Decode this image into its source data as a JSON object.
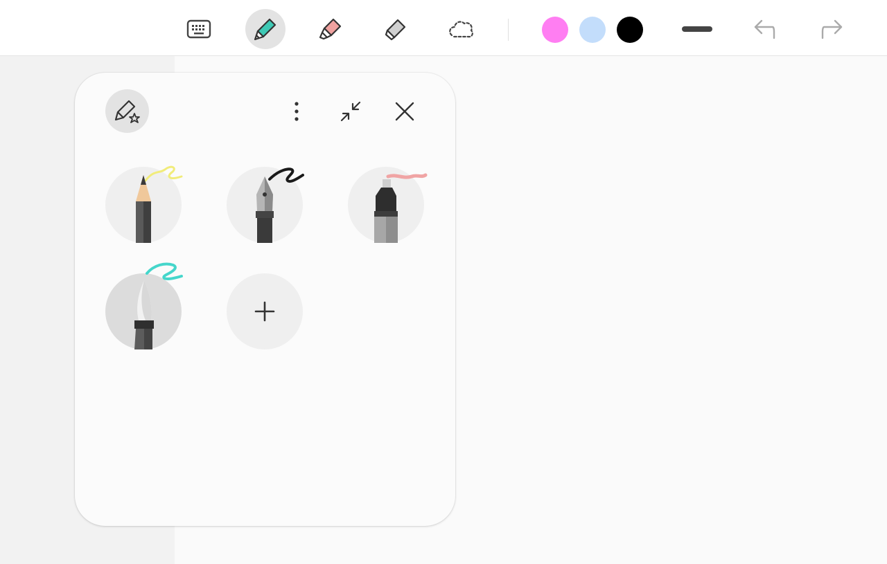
{
  "toolbar": {
    "tools": [
      {
        "name": "keyboard",
        "icon": "keyboard-icon"
      },
      {
        "name": "pen",
        "icon": "pen-icon",
        "active": true,
        "accent": "#3ec9b5"
      },
      {
        "name": "highlighter",
        "icon": "highlighter-icon",
        "accent": "#f0a2a0"
      },
      {
        "name": "eraser",
        "icon": "eraser-icon"
      },
      {
        "name": "lasso",
        "icon": "lasso-icon"
      }
    ],
    "colors": [
      "#ff7ef2",
      "#c3ddfb",
      "#000000"
    ],
    "stroke_icon": "stroke-width-icon",
    "undo_icon": "undo-icon",
    "redo_icon": "redo-icon"
  },
  "pen_panel": {
    "favorites_icon": "favorite-pens-icon",
    "more_icon": "more-options-icon",
    "collapse_icon": "collapse-icon",
    "close_icon": "close-icon",
    "pens": [
      {
        "name": "pencil",
        "stroke_color": "#f1ec7a"
      },
      {
        "name": "fountain-pen",
        "stroke_color": "#1a1a1a"
      },
      {
        "name": "marker",
        "stroke_color": "#f0a4a4"
      },
      {
        "name": "brush",
        "stroke_color": "#45d6cb",
        "selected": true
      }
    ],
    "add_icon": "add-pen-icon"
  }
}
